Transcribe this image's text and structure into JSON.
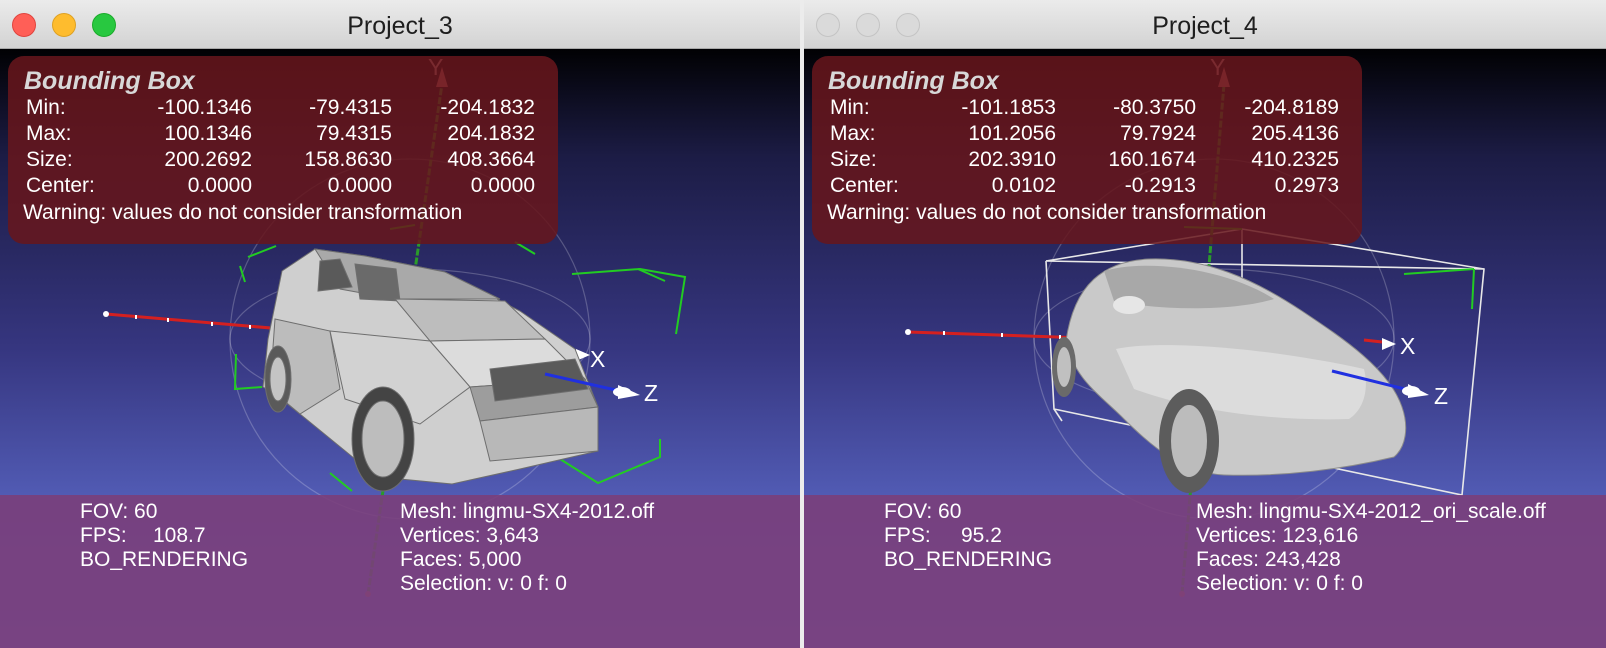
{
  "windows": [
    {
      "title": "Project_3",
      "active": true,
      "bounding_box": {
        "title": "Bounding Box",
        "rows": [
          {
            "label": "Min:",
            "x": "-100.1346",
            "y": "-79.4315",
            "z": "-204.1832"
          },
          {
            "label": "Max:",
            "x": "100.1346",
            "y": "79.4315",
            "z": "204.1832"
          },
          {
            "label": "Size:",
            "x": "200.2692",
            "y": "158.8630",
            "z": "408.3664"
          },
          {
            "label": "Center:",
            "x": "0.0000",
            "y": "0.0000",
            "z": "0.0000"
          }
        ],
        "warning": "Warning: values do not consider transformation"
      },
      "axes": {
        "x": "X",
        "y": "Y",
        "z": "Z"
      },
      "info": {
        "fov": "FOV: 60",
        "fps_label": "FPS:",
        "fps_value": "108.7",
        "mode": "BO_RENDERING",
        "mesh": "Mesh: lingmu-SX4-2012.off",
        "vertices": "Vertices: 3,643",
        "faces": "Faces: 5,000",
        "selection": "Selection: v: 0 f: 0"
      }
    },
    {
      "title": "Project_4",
      "active": false,
      "bounding_box": {
        "title": "Bounding Box",
        "rows": [
          {
            "label": "Min:",
            "x": "-101.1853",
            "y": "-80.3750",
            "z": "-204.8189"
          },
          {
            "label": "Max:",
            "x": "101.2056",
            "y": "79.7924",
            "z": "205.4136"
          },
          {
            "label": "Size:",
            "x": "202.3910",
            "y": "160.1674",
            "z": "410.2325"
          },
          {
            "label": "Center:",
            "x": "0.0102",
            "y": "-0.2913",
            "z": "0.2973"
          }
        ],
        "warning": "Warning: values do not consider transformation"
      },
      "axes": {
        "x": "X",
        "y": "Y",
        "z": "Z"
      },
      "info": {
        "fov": "FOV: 60",
        "fps_label": "FPS:",
        "fps_value": "95.2",
        "mode": "BO_RENDERING",
        "mesh": "Mesh: lingmu-SX4-2012_ori_scale.off",
        "vertices": "Vertices: 123,616",
        "faces": "Faces: 243,428",
        "selection": "Selection: v: 0 f: 0"
      }
    }
  ],
  "colors": {
    "x_axis": "#d42020",
    "y_axis": "#2a9a2a",
    "z_axis": "#2030e0",
    "trackball": "#22cc22",
    "bbox_panel": "#6a161c",
    "info_band": "#7a3e7a"
  },
  "icons": [
    "close-icon",
    "minimize-icon",
    "zoom-icon"
  ]
}
